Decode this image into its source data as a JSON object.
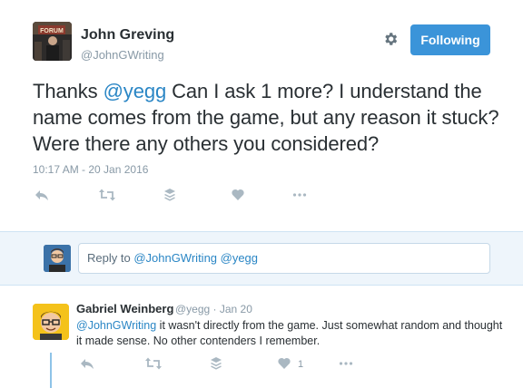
{
  "author": {
    "name": "John Greving",
    "handle": "@JohnGWriting",
    "avatar_sign": "FORUM"
  },
  "follow_button": {
    "label": "Following"
  },
  "tweet": {
    "text_before": "Thanks ",
    "mention": "@yegg",
    "text_after": " Can I ask 1 more? I understand the name comes from the game, but any reason it stuck? Were there any others you considered?",
    "timestamp": "10:17 AM - 20 Jan 2016"
  },
  "actions": [
    "reply-icon",
    "retweet-icon",
    "stack-icon",
    "heart-icon",
    "more-icon"
  ],
  "reply_box": {
    "prefix": "Reply to ",
    "mentions": "@JohnGWriting @yegg"
  },
  "reply": {
    "name": "Gabriel Weinberg",
    "meta": "@yegg · Jan 20",
    "mention": "@JohnGWriting",
    "text": " it wasn't directly from the game. Just somewhat random and thought it made sense. No other contenders I remember.",
    "like_count": "1"
  },
  "colors": {
    "accent": "#3b94d9",
    "mention": "#2a86c5",
    "muted": "#8899a6",
    "reply_bg": "#eef5fb"
  }
}
